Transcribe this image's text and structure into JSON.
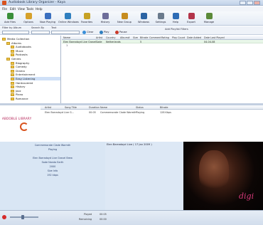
{
  "window": {
    "title": "Audiobook Library Organizer - Kaya"
  },
  "menu": [
    "File",
    "Edit",
    "View",
    "Tools",
    "Help"
  ],
  "toolbar": [
    {
      "label": "Add Files",
      "icon": "add-icon",
      "color": "#3a8f3a"
    },
    {
      "label": "Options",
      "icon": "options-icon",
      "color": "#d6a12a"
    },
    {
      "label": "Now Playing",
      "icon": "play-icon",
      "color": "#3a6fbf"
    },
    {
      "label": "Online Windows",
      "icon": "globe-icon",
      "color": "#2f7fbf"
    },
    {
      "label": "Favorites",
      "icon": "star-icon",
      "color": "#c7a224"
    },
    {
      "label": "History",
      "icon": "history-icon",
      "color": "#6d6d9a"
    },
    {
      "label": "New Group",
      "icon": "folder-icon",
      "color": "#c68c1e"
    },
    {
      "label": "Windows",
      "icon": "window-icon",
      "color": "#2b63a3"
    },
    {
      "label": "Settings",
      "icon": "gear-icon",
      "color": "#6a7a8c"
    },
    {
      "label": "Help",
      "icon": "help-icon",
      "color": "#2d6bb5"
    },
    {
      "label": "Export",
      "icon": "export-icon",
      "color": "#b3344a"
    },
    {
      "label": "Manage",
      "icon": "manage-icon",
      "color": "#5c8a3a"
    }
  ],
  "filter": {
    "label1": "Filter by Album",
    "label2": "Search By",
    "label3": "Text",
    "chips": [
      {
        "label": "Clear",
        "color": "#3a8fd9"
      },
      {
        "label": "Play",
        "color": "#2f7fbf"
      },
      {
        "label": "Pause",
        "color": "#c93a2a"
      }
    ],
    "hint": "Add Playlist Filters"
  },
  "tree": [
    {
      "label": "Media Collection",
      "depth": 0,
      "selected": false
    },
    {
      "label": "Albums",
      "depth": 1,
      "selected": false
    },
    {
      "label": "Audiobooks",
      "depth": 2,
      "selected": false
    },
    {
      "label": "Music",
      "depth": 2,
      "selected": false
    },
    {
      "label": "Podcasts",
      "depth": 2,
      "selected": false
    },
    {
      "label": "Genres",
      "depth": 1,
      "selected": false
    },
    {
      "label": "Biography",
      "depth": 2,
      "selected": false
    },
    {
      "label": "Comedy",
      "depth": 2,
      "selected": false
    },
    {
      "label": "Drama",
      "depth": 2,
      "selected": false
    },
    {
      "label": "Entertainment",
      "depth": 2,
      "selected": false
    },
    {
      "label": "Easy Listening",
      "depth": 2,
      "selected": true
    },
    {
      "label": "Hardcovered",
      "depth": 2,
      "selected": false
    },
    {
      "label": "History",
      "depth": 2,
      "selected": false
    },
    {
      "label": "Jazz",
      "depth": 2,
      "selected": false
    },
    {
      "label": "Piano",
      "depth": 2,
      "selected": false
    },
    {
      "label": "Romance",
      "depth": 2,
      "selected": false
    }
  ],
  "grid": {
    "headers": [
      "Name",
      "Artist",
      "Country",
      "Album#",
      "Size",
      "Bitrate",
      "Comment",
      "Rating",
      "Play Count",
      "Date Added",
      "Date Last Played"
    ],
    "rows": [
      [
        "Elen Barradoyd Live Gravel",
        "Sade",
        "Netherlands",
        "",
        "",
        "5",
        "",
        "",
        "",
        "",
        "04-04-08"
      ]
    ],
    "sub": "1"
  },
  "tracks": {
    "headers": [
      "Artist",
      "Song Title",
      "Duration",
      "Name",
      "Status",
      "Bitrate"
    ],
    "rows": [
      [
        "Elen Barradoyd Live G...",
        "",
        "00:05",
        "Commemorate Clade Warmth",
        "Playing",
        "128 Kbps"
      ]
    ]
  },
  "logo": {
    "text": "ABDOBLE LIBRARY"
  },
  "info": {
    "lines": [
      "Commemorate Clade Warmth",
      "Playing",
      "",
      "Elen Barradoyd Live Gravel Brew",
      "Sade Nanda Earth",
      "2000",
      "Size Info",
      "192 kbps"
    ],
    "title": "Elen Barradoyd Live ( 17 Jan 2009 )"
  },
  "cover": {
    "brand": "digi"
  },
  "status": {
    "played_label": "Played",
    "played_value": "00:05",
    "duration_label": "Remaining",
    "duration_value": "00:00"
  }
}
